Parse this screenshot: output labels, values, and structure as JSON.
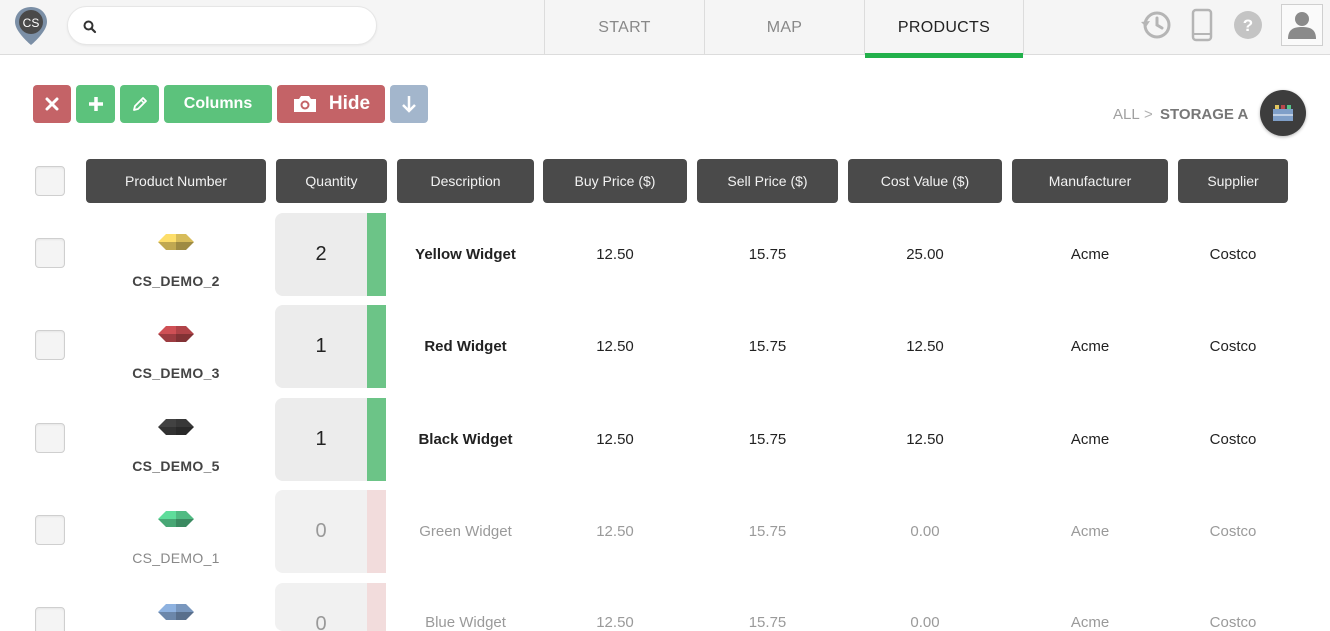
{
  "app": {
    "logo_text": "CS"
  },
  "search": {
    "placeholder": "",
    "value": ""
  },
  "tabs": [
    {
      "label": "START",
      "active": false
    },
    {
      "label": "MAP",
      "active": false
    },
    {
      "label": "PRODUCTS",
      "active": true
    }
  ],
  "header_icons": [
    "history-icon",
    "mobile-device-icon",
    "help-icon",
    "user-avatar-icon"
  ],
  "toolbar": {
    "delete_icon": "close-icon",
    "add_icon": "plus-icon",
    "edit_icon": "pencil-icon",
    "columns_label": "Columns",
    "hide_label": "Hide",
    "hide_icon": "camera-icon",
    "download_icon": "arrow-down-icon"
  },
  "breadcrumb": {
    "all": "ALL",
    "separator": ">",
    "current": "STORAGE A"
  },
  "colors": {
    "accent_green": "#22b04b",
    "button_red": "#c46367",
    "button_green": "#5cc27c",
    "button_slate": "#a3b6cc",
    "header_dark": "#4a4a4a",
    "in_stock": "#6cc487",
    "out_of_stock": "#f2dcdc"
  },
  "table": {
    "columns": [
      "Product Number",
      "Quantity",
      "Description",
      "Buy Price ($)",
      "Sell Price ($)",
      "Cost Value ($)",
      "Manufacturer",
      "Supplier"
    ],
    "rows": [
      {
        "product_number": "CS_DEMO_2",
        "gem_color": "#e2c65f",
        "quantity": "2",
        "in_stock": true,
        "description": "Yellow Widget",
        "buy_price": "12.50",
        "sell_price": "15.75",
        "cost_value": "25.00",
        "manufacturer": "Acme",
        "supplier": "Costco"
      },
      {
        "product_number": "CS_DEMO_3",
        "gem_color": "#b9474c",
        "quantity": "1",
        "in_stock": true,
        "description": "Red Widget",
        "buy_price": "12.50",
        "sell_price": "15.75",
        "cost_value": "12.50",
        "manufacturer": "Acme",
        "supplier": "Costco"
      },
      {
        "product_number": "CS_DEMO_5",
        "gem_color": "#3b3b3b",
        "quantity": "1",
        "in_stock": true,
        "description": "Black Widget",
        "buy_price": "12.50",
        "sell_price": "15.75",
        "cost_value": "12.50",
        "manufacturer": "Acme",
        "supplier": "Costco"
      },
      {
        "product_number": "CS_DEMO_1",
        "gem_color": "#55c58a",
        "quantity": "0",
        "in_stock": false,
        "description": "Green Widget",
        "buy_price": "12.50",
        "sell_price": "15.75",
        "cost_value": "0.00",
        "manufacturer": "Acme",
        "supplier": "Costco"
      },
      {
        "product_number": "",
        "gem_color": "#7f9fc8",
        "quantity": "0",
        "in_stock": false,
        "description": "Blue Widget",
        "buy_price": "12.50",
        "sell_price": "15.75",
        "cost_value": "0.00",
        "manufacturer": "Acme",
        "supplier": "Costco"
      }
    ]
  }
}
